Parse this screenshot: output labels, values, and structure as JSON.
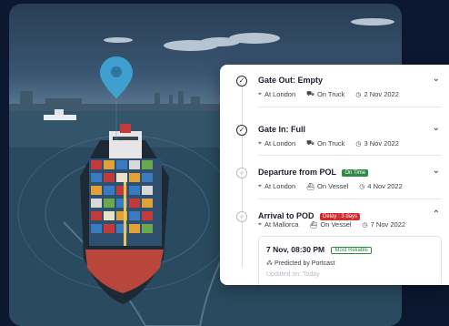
{
  "colors": {
    "background": "#0c1730",
    "panel": "#ffffff",
    "accent_green": "#2e8b44",
    "accent_red": "#d12b2b",
    "pin": "#3fa6d8"
  },
  "illustration": {
    "subject": "container-ship-with-location-pin",
    "pin_icon": "map-pin-icon"
  },
  "events": [
    {
      "title": "Gate Out: Empty",
      "status_icon": "check-circle-icon",
      "badge": "",
      "location": "At London",
      "transport": "On Truck",
      "transport_icon": "truck-icon",
      "date": "2 Nov 2022",
      "expanded": false
    },
    {
      "title": "Gate In: Full",
      "status_icon": "check-circle-icon",
      "badge": "",
      "location": "At London",
      "transport": "On Truck",
      "transport_icon": "truck-icon",
      "date": "3 Nov 2022",
      "expanded": false
    },
    {
      "title": "Departure from POL",
      "status_icon": "pending-circle-icon",
      "badge": "On Time",
      "badge_color": "green",
      "location": "At London",
      "transport": "On Vessel",
      "transport_icon": "vessel-icon",
      "date": "4 Nov 2022",
      "expanded": false
    },
    {
      "title": "Arrival to POD",
      "status_icon": "pending-circle-icon",
      "badge": "Delay : 3 days",
      "badge_color": "red",
      "location": "At Mallorca",
      "transport": "On Vessel",
      "transport_icon": "vessel-icon",
      "date": "7 Nov 2022",
      "expanded": true
    }
  ],
  "prediction": {
    "time": "7 Nov, 08:30 PM",
    "reliability": "Most Reliable",
    "predicted_by": "Predicted by Portcast",
    "updated": "Updated on: Today"
  }
}
